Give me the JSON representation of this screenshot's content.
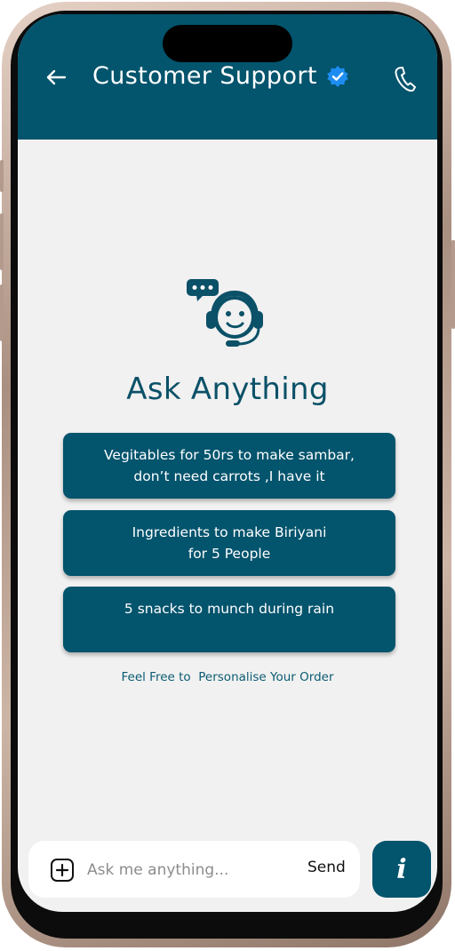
{
  "header": {
    "title": "Customer Support",
    "icons": {
      "back": "arrow-left-icon",
      "verified": "verified-badge-icon",
      "call": "phone-icon"
    },
    "background_color": "#03546d",
    "verified_color": "#1d8df2"
  },
  "main": {
    "illustration": "support-agent-headset-icon",
    "heading": "Ask Anything",
    "suggestions": [
      {
        "line1": "Vegitables for 50rs to make sambar,",
        "line2": "don’t need carrots ,I have it"
      },
      {
        "line1": "Ingredients to make Biriyani",
        "line2": "for 5 People"
      },
      {
        "line1": "5 snacks to munch during rain",
        "line2": ""
      }
    ],
    "tagline": "Feel Free to  Personalise Your Order"
  },
  "composer": {
    "add_icon": "plus-square-icon",
    "placeholder": "Ask me anything...",
    "send_label": "Send",
    "info_label": "i"
  }
}
